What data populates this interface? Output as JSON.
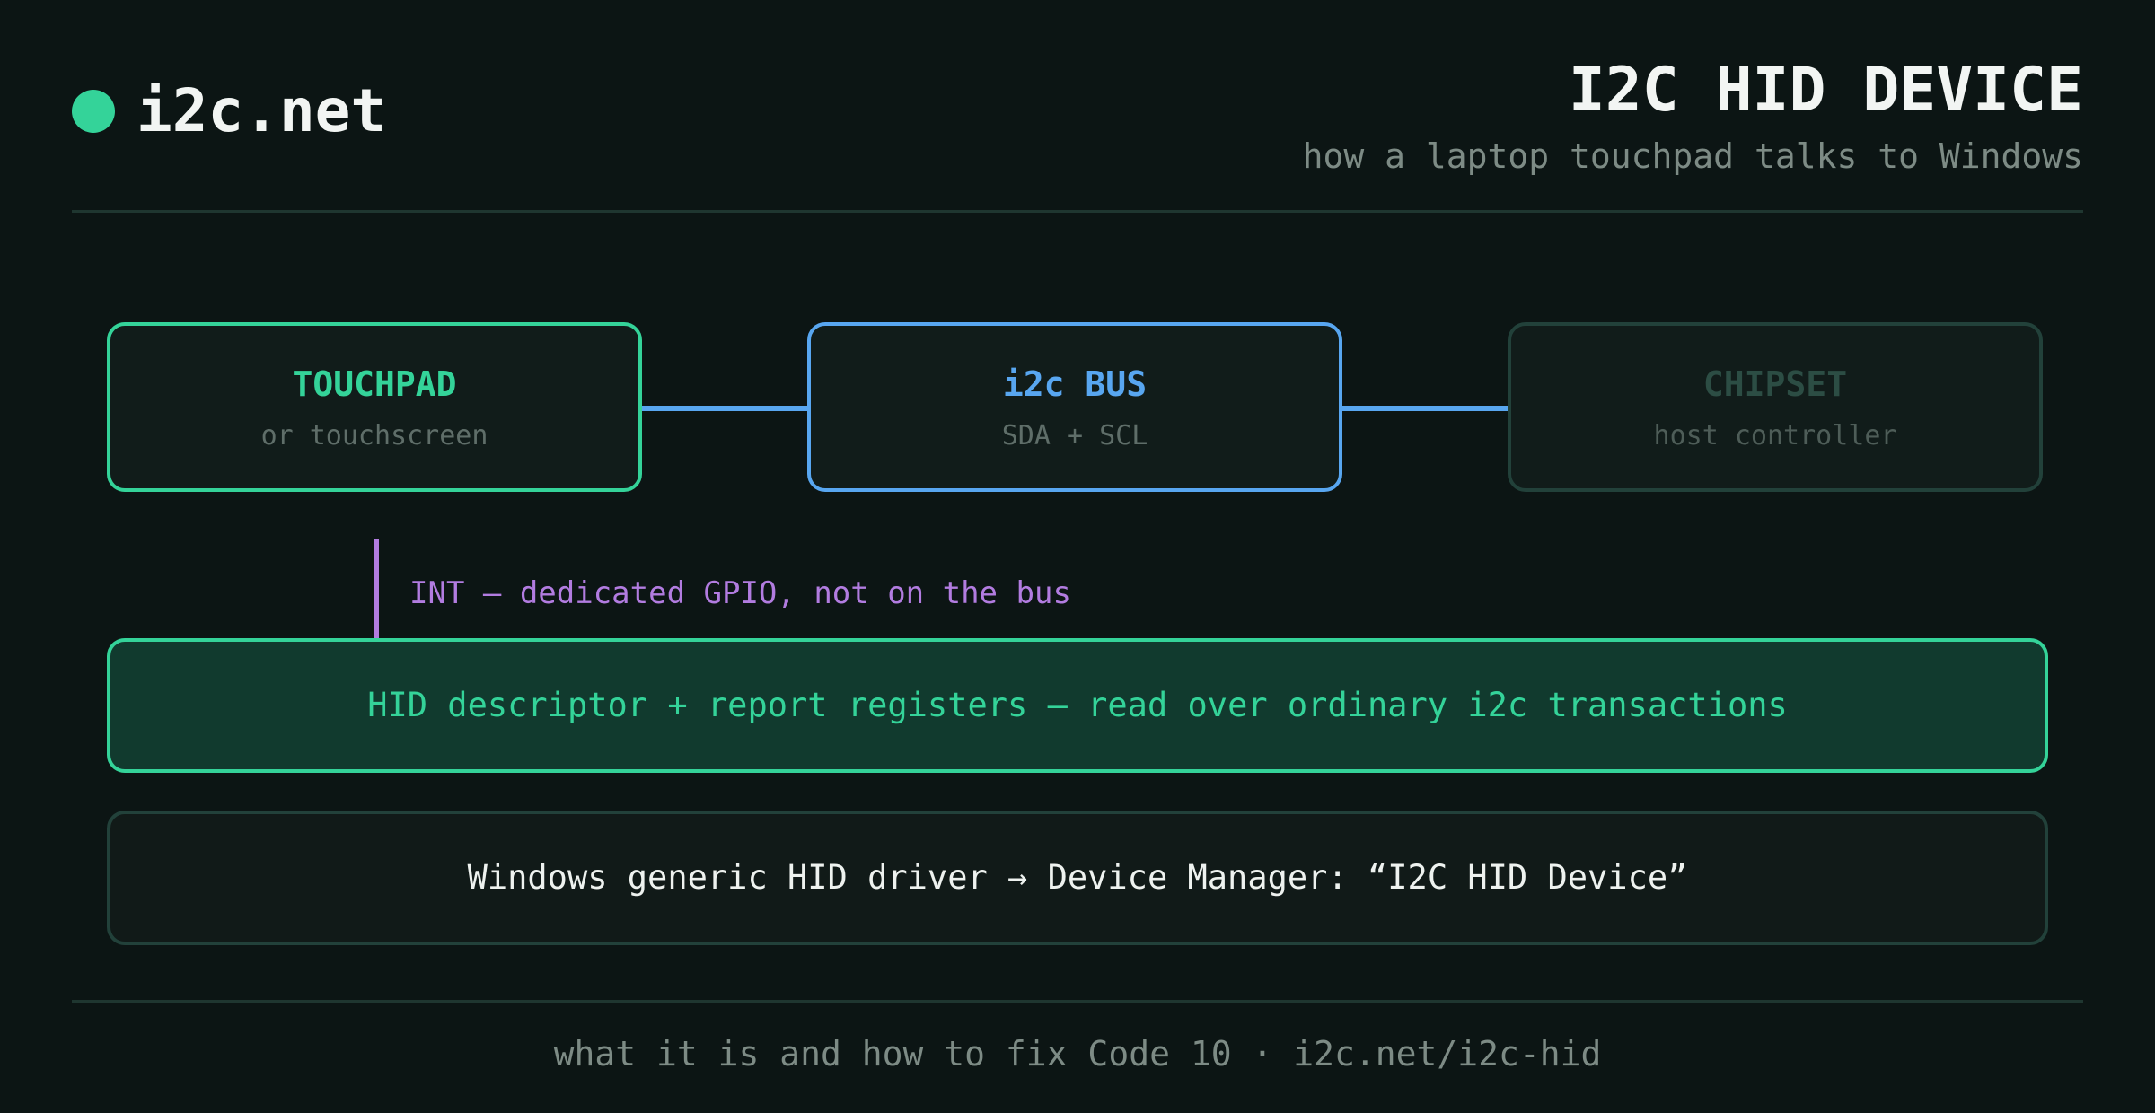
{
  "header": {
    "brand": "i2c.net",
    "title": "I2C HID DEVICE",
    "subtitle": "how a laptop touchpad talks to Windows"
  },
  "diagram": {
    "nodes": [
      {
        "title": "TOUCHPAD",
        "subtitle": "or touchscreen"
      },
      {
        "title": "i2c BUS",
        "subtitle": "SDA + SCL"
      },
      {
        "title": "CHIPSET",
        "subtitle": "host controller"
      }
    ],
    "interrupt_label": "INT — dedicated GPIO, not on the bus",
    "hid_band": "HID descriptor + report registers — read over ordinary i2c transactions",
    "windows_band": "Windows generic HID driver → Device Manager: “I2C HID Device”"
  },
  "footer": {
    "text": "what it is and how to fix Code 10 · i2c.net/i2c-hid"
  },
  "colors": {
    "background": "#0c1514",
    "accent_green": "#34d399",
    "accent_blue": "#58a6f0",
    "accent_purple": "#b27ce0",
    "muted_border": "#22413a"
  }
}
